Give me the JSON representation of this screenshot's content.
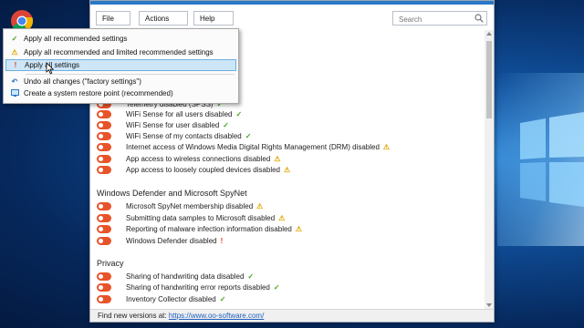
{
  "menubar": {
    "file": "File",
    "actions": "Actions",
    "help": "Help",
    "search_placeholder": "Search"
  },
  "dropdown": {
    "items": [
      {
        "label": "Apply all recommended settings",
        "icon": "check-icon",
        "color": "#4aa61f"
      },
      {
        "label": "Apply all recommended and limited recommended settings",
        "icon": "warning-icon",
        "color": "#e0a800"
      },
      {
        "label": "Apply all settings",
        "icon": "exclamation-icon",
        "color": "#e53a1d"
      },
      {
        "label": "Undo all changes (\"factory settings\")",
        "icon": "undo-icon",
        "color": "#2b78c6"
      },
      {
        "label": "Create a system restore point (recommended)",
        "icon": "restore-point-icon",
        "color": "#2b78c6"
      }
    ]
  },
  "rows_top": [
    {
      "label": "Telemetry disabled (SPSS)",
      "mark": "✓",
      "kind": "check"
    },
    {
      "label": "WiFi Sense for all users disabled",
      "mark": "✓",
      "kind": "check"
    },
    {
      "label": "WiFi Sense for user disabled",
      "mark": "✓",
      "kind": "check"
    },
    {
      "label": "WiFi Sense of my contacts disabled",
      "mark": "✓",
      "kind": "check"
    },
    {
      "label": "Internet access of Windows Media Digital Rights Management (DRM) disabled",
      "mark": "⚠",
      "kind": "warn"
    },
    {
      "label": "App access to wireless connections disabled",
      "mark": "⚠",
      "kind": "warn"
    },
    {
      "label": "App access to loosely coupled devices disabled",
      "mark": "⚠",
      "kind": "warn"
    }
  ],
  "section_defender": {
    "title": "Windows Defender and Microsoft SpyNet",
    "rows": [
      {
        "label": "Microsoft SpyNet membership disabled",
        "mark": "⚠",
        "kind": "warn"
      },
      {
        "label": "Submitting data samples to Microsoft disabled",
        "mark": "⚠",
        "kind": "warn"
      },
      {
        "label": "Reporting of malware infection information disabled",
        "mark": "⚠",
        "kind": "warn"
      },
      {
        "label": "Windows Defender disabled",
        "mark": "!",
        "kind": "excl"
      }
    ]
  },
  "section_privacy": {
    "title": "Privacy",
    "rows": [
      {
        "label": "Sharing of handwriting data disabled",
        "mark": "✓",
        "kind": "check"
      },
      {
        "label": "Sharing of handwriting error reports disabled",
        "mark": "✓",
        "kind": "check"
      },
      {
        "label": "Inventory Collector disabled",
        "mark": "✓",
        "kind": "check"
      }
    ]
  },
  "statusbar": {
    "text": "Find new versions at:",
    "link": "https://www.oo-software.com/"
  },
  "colors": {
    "toggle_off": "#e8542a",
    "accent": "#2b78c6"
  }
}
